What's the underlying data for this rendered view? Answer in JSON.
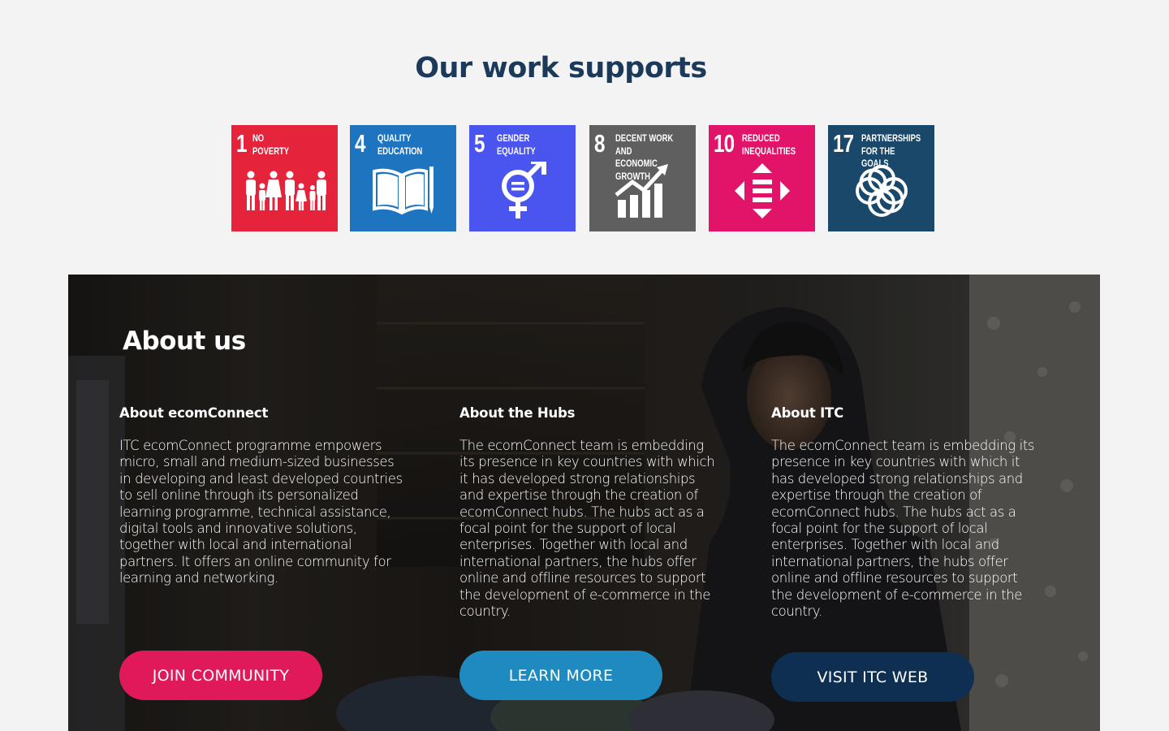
{
  "supports": {
    "title": "Our work supports",
    "goals": [
      {
        "number": "1",
        "label": "NO\nPOVERTY",
        "color": "#e5243b",
        "icon": "family-icon"
      },
      {
        "number": "4",
        "label": "QUALITY\nEDUCATION",
        "color": "#1f74c0",
        "icon": "book-icon"
      },
      {
        "number": "5",
        "label": "GENDER\nEQUALITY",
        "color": "#4a55f0",
        "icon": "gender-equality-icon"
      },
      {
        "number": "8",
        "label": "DECENT WORK AND\nECONOMIC GROWTH",
        "color": "#5f5f5f",
        "icon": "growth-chart-icon"
      },
      {
        "number": "10",
        "label": "REDUCED\nINEQUALITIES",
        "color": "#e1146a",
        "icon": "equality-arrows-icon"
      },
      {
        "number": "17",
        "label": "PARTNERSHIPS\nFOR THE GOALS",
        "color": "#19486a",
        "icon": "partnership-flower-icon"
      }
    ]
  },
  "about": {
    "title": "About us",
    "columns": [
      {
        "heading": "About ecomConnect",
        "body": "ITC ecomConnect programme empowers micro, small and medium-sized businesses in developing and least developed countries to sell online through its personalized learning programme, technical assistance, digital tools and innovative solutions, together with local and international partners. It offers an online community for learning and networking.",
        "button": "JOIN COMMUNITY",
        "button_color": "#e0195b"
      },
      {
        "heading": "About the Hubs",
        "body": "The ecomConnect team is embedding its presence in key countries with which it has developed strong relationships and expertise through the creation of ecomConnect hubs. The hubs act as a focal point for the support of local enterprises. Together with local and international partners, the hubs offer online and offline resources to support the development of e-commerce in the country.",
        "button": "LEARN MORE",
        "button_color": "#1f8ac0"
      },
      {
        "heading": "About ITC",
        "body": "The ecomConnect team is embedding its presence in key countries with which it has developed strong relationships and expertise through the creation of ecomConnect hubs. The hubs act as a focal point for the support of local enterprises. Together with local and international partners, the hubs offer online and offline resources to support the development of e-commerce in the country.",
        "button": "VISIT ITC WEB",
        "button_color": "#0e2f52"
      }
    ]
  }
}
